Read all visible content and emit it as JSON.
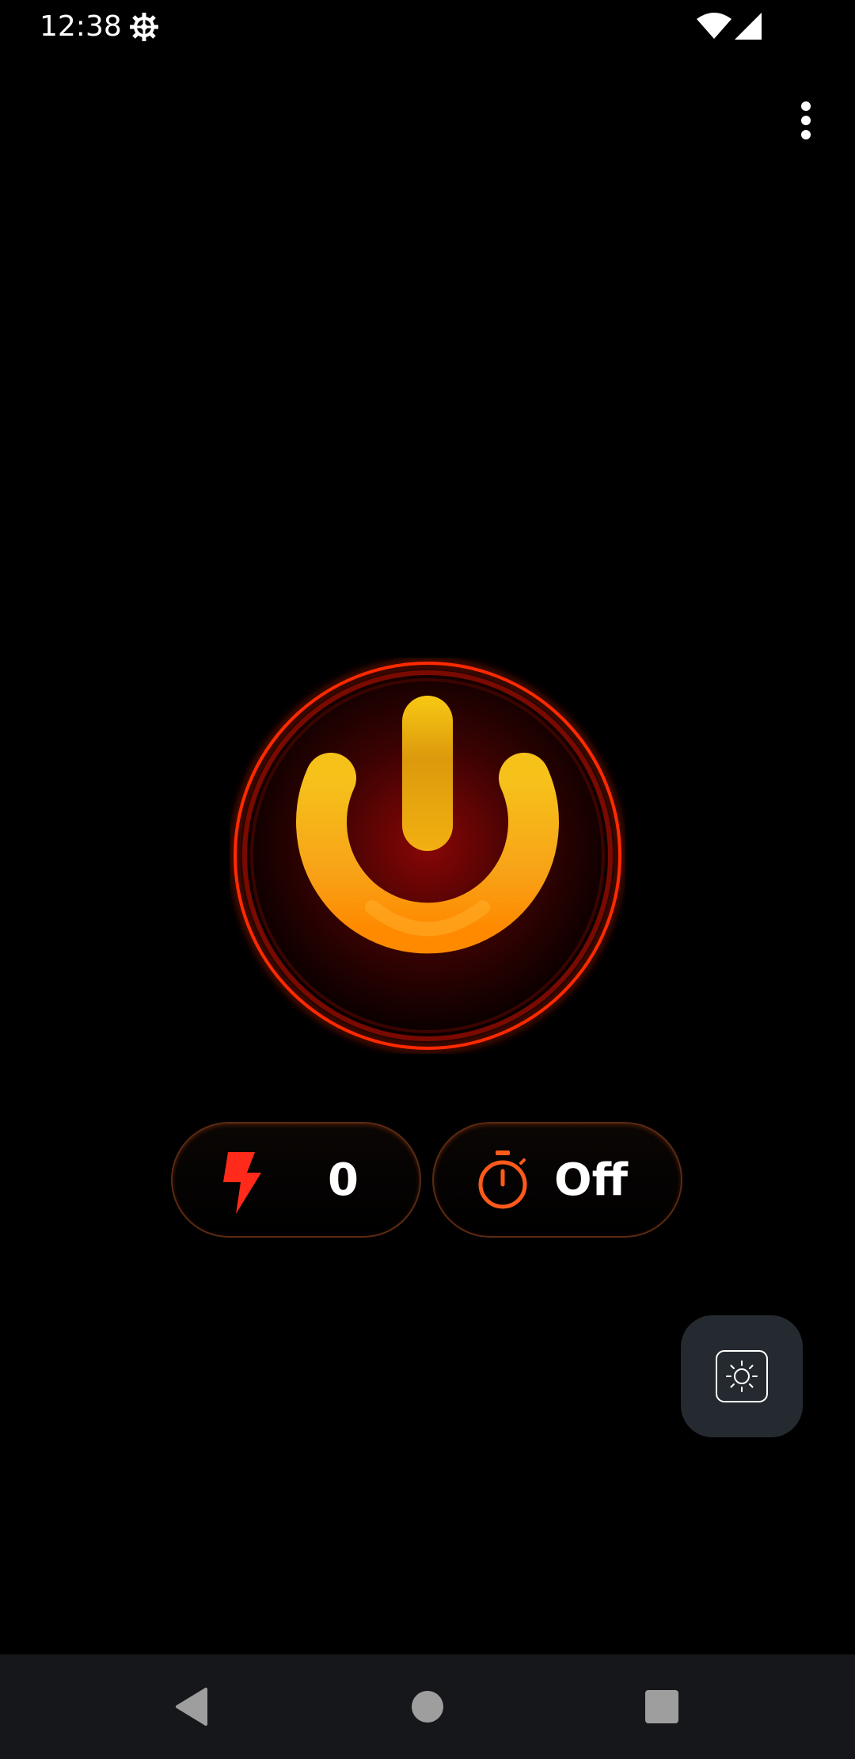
{
  "status_bar": {
    "time": "12:38",
    "icons": [
      "gear-icon",
      "wifi-icon",
      "signal-icon"
    ]
  },
  "toolbar": {
    "overflow_icon": "more-vert-icon"
  },
  "power": {
    "icon": "power-icon",
    "colors": {
      "ring": "#ff3b10",
      "glow": "#ff2a00",
      "symbol_top": "#f6c21a",
      "symbol_bottom": "#ff8a00",
      "center": "#8a0606"
    }
  },
  "controls": {
    "flash": {
      "icon": "lightning-icon",
      "value": "0",
      "color": "#ff2a1a"
    },
    "timer": {
      "icon": "stopwatch-icon",
      "value": "Off",
      "color": "#ff5a1a"
    }
  },
  "fab": {
    "icon": "brightness-icon",
    "background": "#242a30"
  },
  "nav_bar": {
    "icons": [
      "back-icon",
      "home-icon",
      "recents-icon"
    ],
    "color": "#9e9e9e"
  }
}
